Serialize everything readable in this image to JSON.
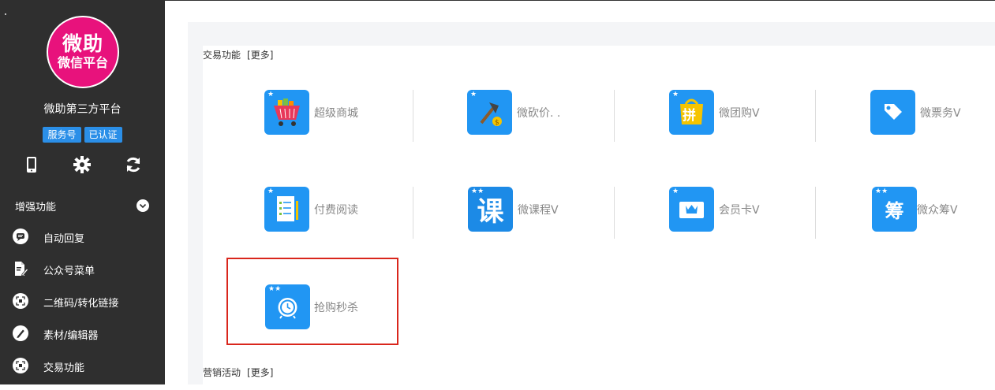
{
  "sidebar": {
    "logo": {
      "line1": "微助",
      "line2": "微信平台"
    },
    "site_name": "微助第三方平台",
    "badges": [
      "服务号",
      "已认证"
    ],
    "quick_icons": [
      "phone-icon",
      "gear-icon",
      "refresh-icon"
    ],
    "section": "增强功能",
    "menu": [
      {
        "label": "自动回复",
        "icon": "chat-icon"
      },
      {
        "label": "公众号菜单",
        "icon": "document-edit-icon"
      },
      {
        "label": "二维码/转化链接",
        "icon": "qrcode-icon"
      },
      {
        "label": "素材/编辑器",
        "icon": "pencil-icon"
      },
      {
        "label": "交易功能",
        "icon": "qrcode-icon"
      }
    ]
  },
  "main": {
    "sections": [
      {
        "title": "交易功能",
        "more": "[更多]",
        "tiles": [
          {
            "label": "超级商城",
            "icon": "shopping-cart-icon"
          },
          {
            "label": "微砍价. .",
            "icon": "axe-price-icon"
          },
          {
            "label": "微团购V",
            "icon": "group-buy-icon"
          },
          {
            "label": "微票务V",
            "icon": "ticket-icon"
          },
          {
            "label": "付费阅读",
            "icon": "checklist-icon"
          },
          {
            "label": "微课程V",
            "icon": "course-icon",
            "glyph": "课"
          },
          {
            "label": "会员卡V",
            "icon": "member-card-icon"
          },
          {
            "label": "微众筹V",
            "icon": "crowdfunding-icon",
            "glyph": "筹"
          },
          {
            "label": "抢购秒杀",
            "icon": "alarm-clock-icon"
          }
        ]
      },
      {
        "title": "营销活动",
        "more": "[更多]"
      }
    ]
  },
  "colors": {
    "sidebar_bg": "#2f2f2f",
    "logo_pink": "#e8127c",
    "badge_blue": "#2b8fe8",
    "tile_blue": "#2196f3",
    "highlight_red": "#d9261c"
  }
}
